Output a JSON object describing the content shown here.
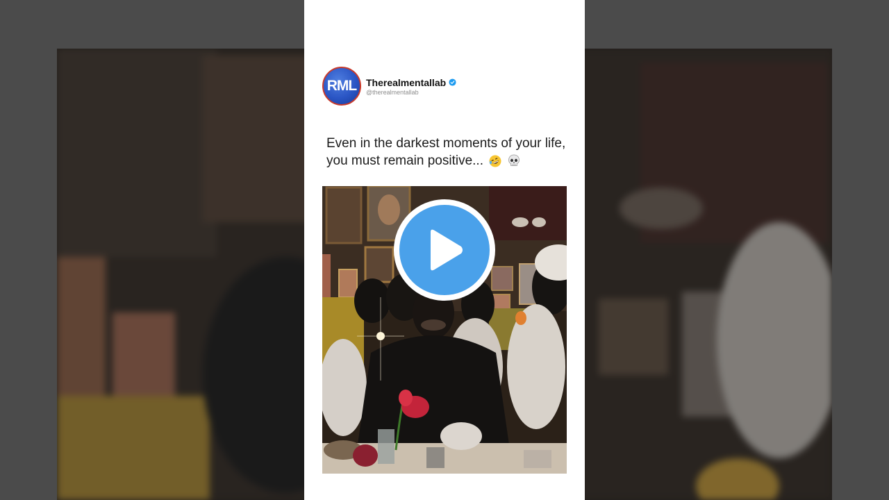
{
  "post": {
    "avatar_text": "RML",
    "display_name": "Therealmentallab",
    "handle": "@therealmentallab",
    "verified": true,
    "text_line1": "Even in the darkest moments of your life,",
    "text_line2": "you must remain positive...",
    "emojis": [
      "rolling-on-floor-laughing-emoji",
      "skull-emoji"
    ]
  },
  "video": {
    "play_icon": "play-icon",
    "accent_color": "#4aa1ea"
  },
  "colors": {
    "avatar_blue": "#2a55c4",
    "avatar_ring": "#c93a2b",
    "verified_blue": "#1d9bf0",
    "page_bg": "#4b4b4b"
  }
}
